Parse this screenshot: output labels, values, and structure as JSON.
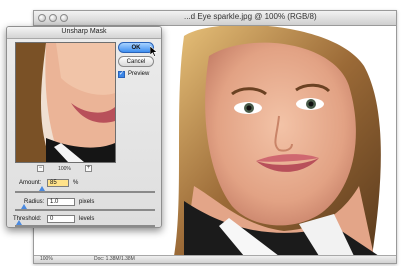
{
  "document": {
    "title": "...d Eye sparkle.jpg @ 100% (RGB/8)",
    "status_zoom": "100%",
    "status_doc": "Doc: 1.38M/1.38M"
  },
  "dialog": {
    "title": "Unsharp Mask",
    "ok_label": "OK",
    "cancel_label": "Cancel",
    "preview_label": "Preview",
    "preview_checked": true,
    "zoom_label": "100%",
    "zoom_out": "−",
    "zoom_in": "+",
    "amount": {
      "label": "Amount:",
      "value": "85",
      "unit": "%",
      "level": 0.17
    },
    "radius": {
      "label": "Radius:",
      "value": "1.0",
      "unit": "pixels",
      "level": 0.04
    },
    "threshold": {
      "label": "Threshold:",
      "value": "0",
      "unit": "levels",
      "level": 0.0
    }
  },
  "colors": {
    "ok_button": "#3f8ff0",
    "field_highlight": "#ffe28a",
    "slider_thumb": "#4b8ae0"
  }
}
